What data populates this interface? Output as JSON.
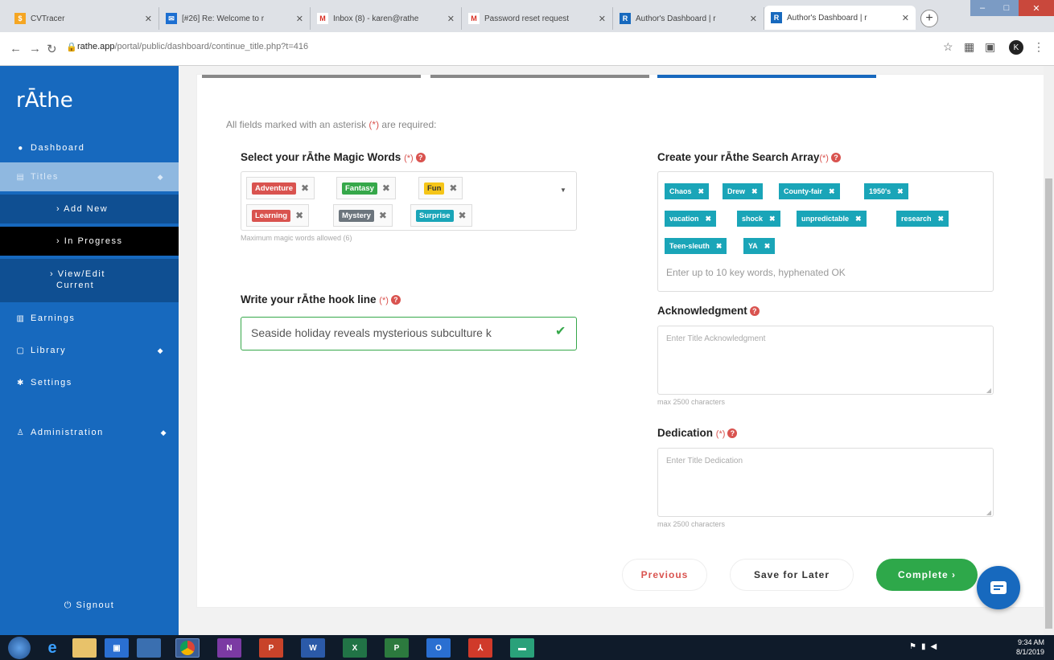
{
  "browser": {
    "tabs": [
      {
        "title": "CVTracer",
        "icon": "cvtracer-icon",
        "color": "#f5a623"
      },
      {
        "title": "[#26] Re: Welcome to r",
        "icon": "mail-icon",
        "color": "#1c6fd1"
      },
      {
        "title": "Inbox (8) - karen@rathe",
        "icon": "gmail-icon",
        "color": "#d93025"
      },
      {
        "title": "Password reset request",
        "icon": "gmail-icon",
        "color": "#d93025"
      },
      {
        "title": "Author's Dashboard | r",
        "icon": "rathe-icon",
        "color": "#1769be"
      },
      {
        "title": "Author's Dashboard | r",
        "icon": "rathe-icon",
        "color": "#1769be"
      }
    ],
    "url_host": "rathe.app",
    "url_path": "/portal/public/dashboard/continue_title.php?t=416",
    "avatar_letter": "K"
  },
  "sidebar": {
    "logo": "rĀthe",
    "items": [
      {
        "label": "Dashboard",
        "icon": "palette-icon"
      },
      {
        "label": "Titles",
        "icon": "books-icon"
      },
      {
        "label": "Earnings",
        "icon": "chart-icon"
      },
      {
        "label": "Library",
        "icon": "library-icon"
      },
      {
        "label": "Settings",
        "icon": "gear-icon"
      },
      {
        "label": "Administration",
        "icon": "admin-icon"
      }
    ],
    "sub_items": [
      {
        "label": "› Add New"
      },
      {
        "label": "› In Progress"
      },
      {
        "label": "› View/Edit"
      },
      {
        "label": "Current"
      }
    ],
    "signout": "Signout"
  },
  "form": {
    "required_note_pre": "All fields marked with an asterisk ",
    "required_note_ast": "(*)",
    "required_note_post": " are required:",
    "magic_words_label": "Select your rĀthe Magic Words",
    "required_marker": "(*)",
    "magic_words": [
      {
        "label": "Adventure",
        "color": "#d9534f"
      },
      {
        "label": "Fantasy",
        "color": "#36a84a"
      },
      {
        "label": "Fun",
        "color": "#f5c518"
      },
      {
        "label": "Learning",
        "color": "#d9534f"
      },
      {
        "label": "Mystery",
        "color": "#6c757d"
      },
      {
        "label": "Surprise",
        "color": "#1aa5b8"
      }
    ],
    "magic_words_hint": "Maximum magic words allowed (6)",
    "hook_label": "Write your rĀthe hook line",
    "hook_value": "Seaside holiday reveals mysterious subculture k",
    "search_array_label": "Create your rĀthe Search Array",
    "keywords": [
      "Chaos",
      "Drew",
      "County-fair",
      "1950's",
      "vacation",
      "shock",
      "unpredictable",
      "research",
      "Teen-sleuth",
      "YA"
    ],
    "keywords_placeholder": "Enter up to 10 key words, hyphenated OK",
    "ack_label": "Acknowledgment",
    "ack_placeholder": "Enter Title Acknowledgment",
    "ack_hint": "max 2500 characters",
    "ded_label": "Dedication",
    "ded_placeholder": "Enter Title Dedication",
    "ded_hint": "max 2500 characters"
  },
  "buttons": {
    "previous": "Previous",
    "save": "Save for Later",
    "complete": "Complete ›"
  },
  "taskbar": {
    "apps": [
      "IE",
      "Files",
      "Outlook",
      "Chrome",
      "OneNote",
      "PowerPoint",
      "Word",
      "Excel",
      "Project",
      "Outlook",
      "Acrobat",
      "Explorer"
    ],
    "time": "9:34 AM",
    "date": "8/1/2019"
  }
}
